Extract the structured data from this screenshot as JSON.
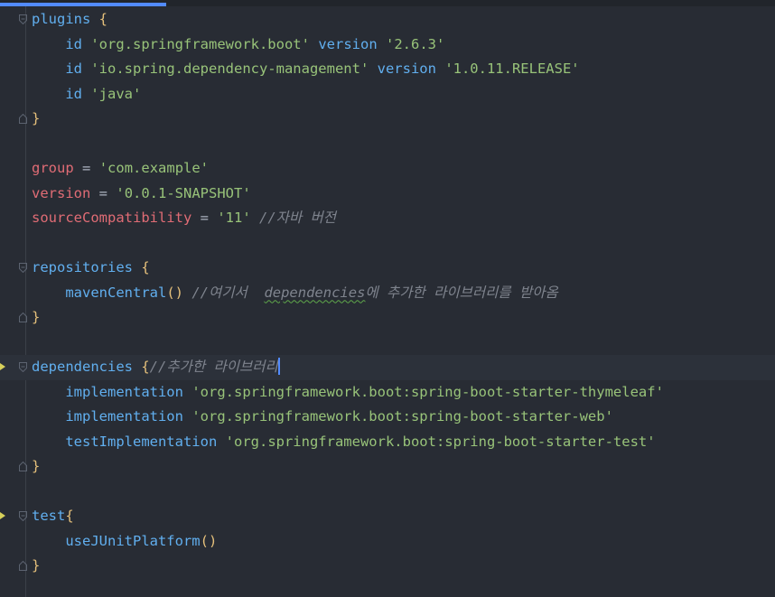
{
  "colors": {
    "background": "#282c34",
    "keyword": "#61afef",
    "property": "#e06c75",
    "string": "#98c379",
    "brace": "#e5c07b",
    "comment": "#7f848e",
    "caret": "#528bff",
    "run_marker": "#d7d05a"
  },
  "icons": {
    "fold": "fold-marker-icon",
    "run": "run-gutter-icon"
  },
  "code": {
    "plugins": {
      "keyword": "plugins",
      "open": "{",
      "id_kw": "id",
      "version_kw": "version",
      "boot_id": "'org.springframework.boot'",
      "boot_ver": "'2.6.3'",
      "dm_id": "'io.spring.dependency-management'",
      "dm_ver": "'1.0.11.RELEASE'",
      "java_id": "'java'",
      "close": "}"
    },
    "props": {
      "group_key": "group",
      "group_val": "'com.example'",
      "version_key": "version",
      "version_val": "'0.0.1-SNAPSHOT'",
      "source_key": "sourceCompatibility",
      "source_val": "'11'",
      "source_comment": "//자바 버전",
      "eq": "="
    },
    "repositories": {
      "keyword": "repositories",
      "maven": "mavenCentral",
      "parens": "()",
      "comment_pre": "//여기서  ",
      "comment_word": "dependencies",
      "comment_post": "에 추가한 라이브러리를 받아옴"
    },
    "dependencies": {
      "keyword": "dependencies",
      "comment": "//추가한 라이브러리",
      "impl_kw": "implementation",
      "test_impl_kw": "testImplementation",
      "dep1": "'org.springframework.boot:spring-boot-starter-thymeleaf'",
      "dep2": "'org.springframework.boot:spring-boot-starter-web'",
      "dep3": "'org.springframework.boot:spring-boot-starter-test'"
    },
    "test": {
      "keyword": "test",
      "call": "useJUnitPlatform",
      "parens": "()"
    }
  }
}
